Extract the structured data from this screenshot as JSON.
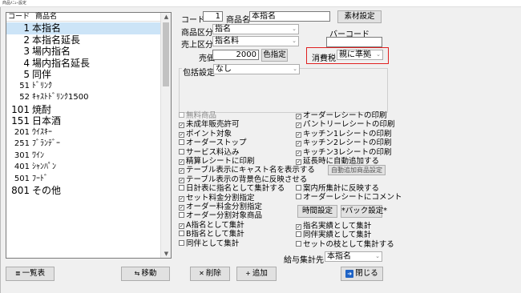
{
  "window": {
    "title": "商品ﾒﾆｭｰ設定"
  },
  "list": {
    "header_code": "コード",
    "header_name": "商品名",
    "items": [
      {
        "code": "1",
        "name": "本指名",
        "selected": true
      },
      {
        "code": "2",
        "name": "本指名延長"
      },
      {
        "code": "3",
        "name": "場内指名"
      },
      {
        "code": "4",
        "name": "場内指名延長"
      },
      {
        "code": "5",
        "name": "同伴"
      },
      {
        "code": "51",
        "name": "ﾄﾞﾘﾝｸ"
      },
      {
        "code": "52",
        "name": "ｷｬｽﾄﾄﾞﾘﾝｸ1500"
      },
      {
        "code": "101",
        "name": "焼酎"
      },
      {
        "code": "151",
        "name": "日本酒"
      },
      {
        "code": "201",
        "name": "ｳｲｽｷｰ"
      },
      {
        "code": "251",
        "name": "ﾌﾞﾗﾝﾃﾞｰ"
      },
      {
        "code": "301",
        "name": "ﾜｲﾝ"
      },
      {
        "code": "401",
        "name": "ｼｬﾝﾊﾟﾝ"
      },
      {
        "code": "501",
        "name": "ﾌｰﾄﾞ"
      },
      {
        "code": "801",
        "name": "その他"
      }
    ]
  },
  "form": {
    "code_label": "コード",
    "code_value": "1",
    "name_label": "商品名",
    "name_value": "本指名",
    "material_button": "素材設定",
    "category_label": "商品区分",
    "category_value": "指名",
    "sales_category_label": "売上区分",
    "sales_category_value": "指名料",
    "barcode_label": "バーコード",
    "barcode_value": "",
    "price_label": "売価",
    "price_value": "2000",
    "color_button": "色指定",
    "tax_label": "消費税",
    "tax_value": "親に準拠",
    "inclusive_label": "包括設定",
    "inclusive_value": "なし"
  },
  "checks_left": [
    {
      "label": "無料商品",
      "checked": false,
      "disabled": true
    },
    {
      "label": "未成年販売許可",
      "checked": true
    },
    {
      "label": "ポイント対象",
      "checked": true
    },
    {
      "label": "オーダーストップ",
      "checked": false
    },
    {
      "label": "サービス料込み",
      "checked": false
    },
    {
      "label": "精算レシートに印刷",
      "checked": true
    },
    {
      "label": "テーブル表示にキャスト名を表示する",
      "checked": true
    },
    {
      "label": "テーブル表示の背景色に反映させる",
      "checked": true
    },
    {
      "label": "日計表に指名として集計する",
      "checked": false
    },
    {
      "label": "セット料金分割指定",
      "checked": true
    },
    {
      "label": "オーダー料金分割指定",
      "checked": true
    },
    {
      "label": "オーダー分割対象商品",
      "checked": false
    },
    {
      "label": "A指名として集計",
      "checked": true
    },
    {
      "label": "B指名として集計",
      "checked": false
    },
    {
      "label": "同伴として集計",
      "checked": false
    }
  ],
  "checks_right_top": [
    {
      "label": "オーダーレシートの印刷",
      "checked": true
    },
    {
      "label": "パントリーレシートの印刷",
      "checked": true
    },
    {
      "label": "キッチン1レシートの印刷",
      "checked": true
    },
    {
      "label": "キッチン2レシートの印刷",
      "checked": true
    },
    {
      "label": "キッチン3レシートの印刷",
      "checked": true
    },
    {
      "label": "延長時に自動追加する",
      "checked": true
    }
  ],
  "auto_add_button": "自動追加商品設定",
  "checks_right_mid": [
    {
      "label": "案内所集計に反映する",
      "checked": false
    },
    {
      "label": "オーダーレシートにコメント",
      "checked": false
    }
  ],
  "time_button": "時間設定",
  "back_button": "*バック設定*",
  "checks_right_bottom": [
    {
      "label": "指名実績として集計",
      "checked": true
    },
    {
      "label": "同伴実績として集計",
      "checked": false
    },
    {
      "label": "セットの枝として集計する",
      "checked": false
    }
  ],
  "salary": {
    "label": "給与集計先",
    "value": "本指名"
  },
  "footer": {
    "list_button": "一覧表",
    "move_button": "移動",
    "delete_button": "削除",
    "add_button": "追加",
    "close_button": "閉じる"
  },
  "colors": {
    "selection": "#cce4f7",
    "highlight_border": "#e02020",
    "close_icon": "#1e63c6"
  }
}
